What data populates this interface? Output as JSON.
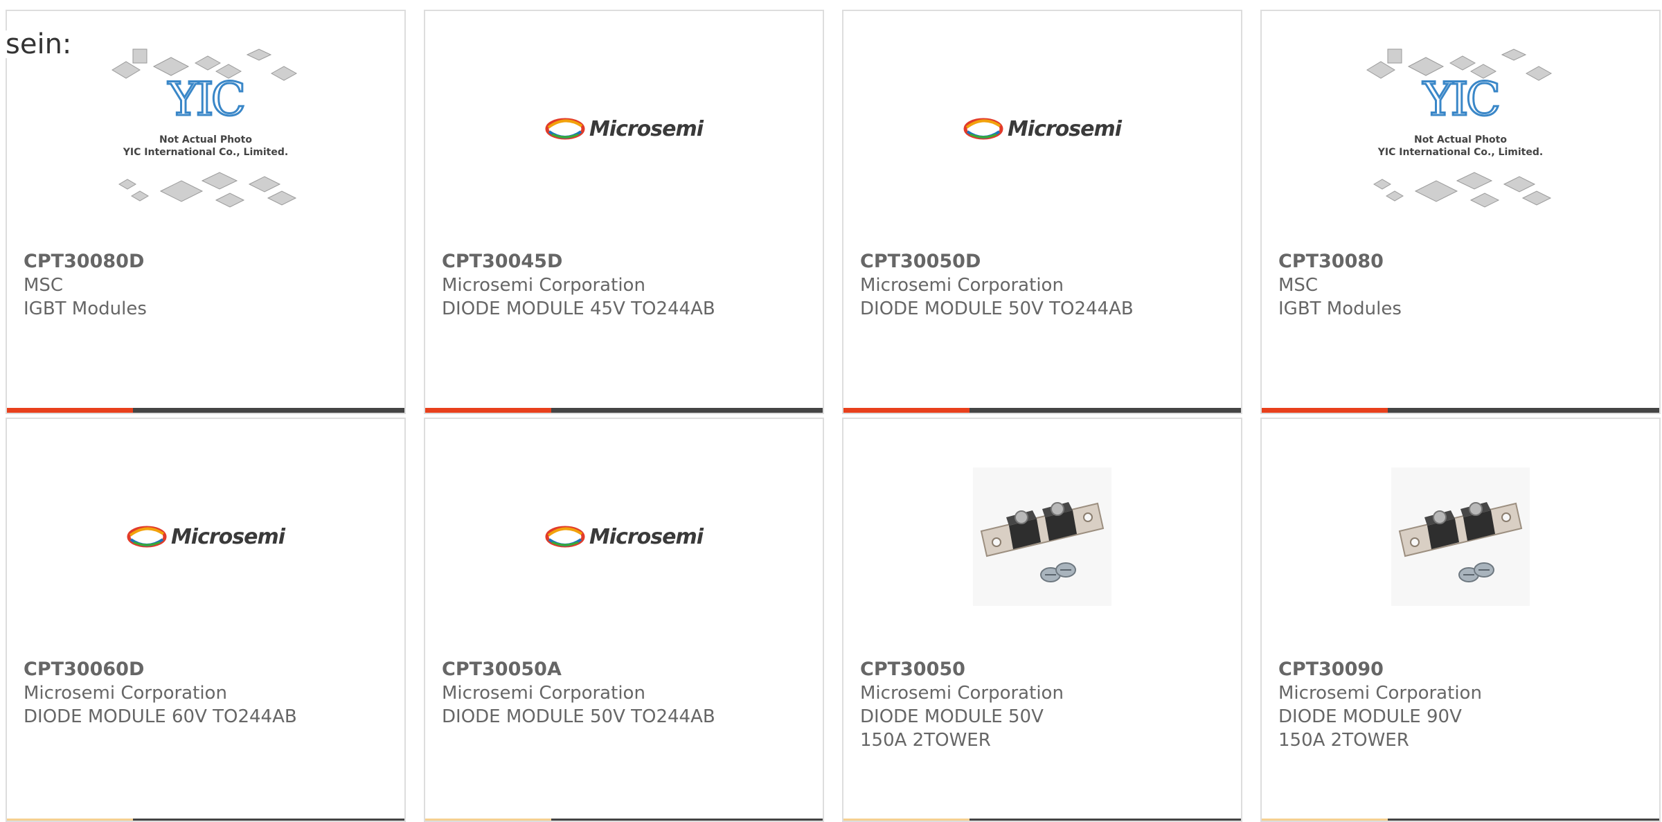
{
  "intro_text": "sein:",
  "icons": {
    "microsemi_logo": "microsemi-logo-icon",
    "yic_placeholder": "yic-placeholder-image",
    "diode_module": "diode-module-photo"
  },
  "colors": {
    "accent": "#e8401c",
    "bar": "#444444",
    "text": "#666666",
    "border": "#dddddd"
  },
  "logos": {
    "microsemi": "Microsemi"
  },
  "placeholder": {
    "yic_mark": "YIC",
    "line1": "Not Actual Photo",
    "line2": "YIC International Co., Limited."
  },
  "products": [
    {
      "part": "CPT30080D",
      "maker": "MSC",
      "desc": "IGBT Modules",
      "image": "yic"
    },
    {
      "part": "CPT30045D",
      "maker": "Microsemi Corporation",
      "desc": "DIODE MODULE 45V TO244AB",
      "image": "microsemi"
    },
    {
      "part": "CPT30050D",
      "maker": "Microsemi Corporation",
      "desc": "DIODE MODULE 50V TO244AB",
      "image": "microsemi"
    },
    {
      "part": "CPT30080",
      "maker": "MSC",
      "desc": "IGBT Modules",
      "image": "yic"
    },
    {
      "part": "CPT30060D",
      "maker": "Microsemi Corporation",
      "desc": "DIODE MODULE 60V TO244AB",
      "image": "microsemi"
    },
    {
      "part": "CPT30050A",
      "maker": "Microsemi Corporation",
      "desc": "DIODE MODULE 50V TO244AB",
      "image": "microsemi"
    },
    {
      "part": "CPT30050",
      "maker": "Microsemi Corporation",
      "desc": "DIODE MODULE 50V 150A 2TOWER",
      "image": "module"
    },
    {
      "part": "CPT30090",
      "maker": "Microsemi Corporation",
      "desc": "DIODE MODULE 90V 150A 2TOWER",
      "image": "module"
    }
  ]
}
